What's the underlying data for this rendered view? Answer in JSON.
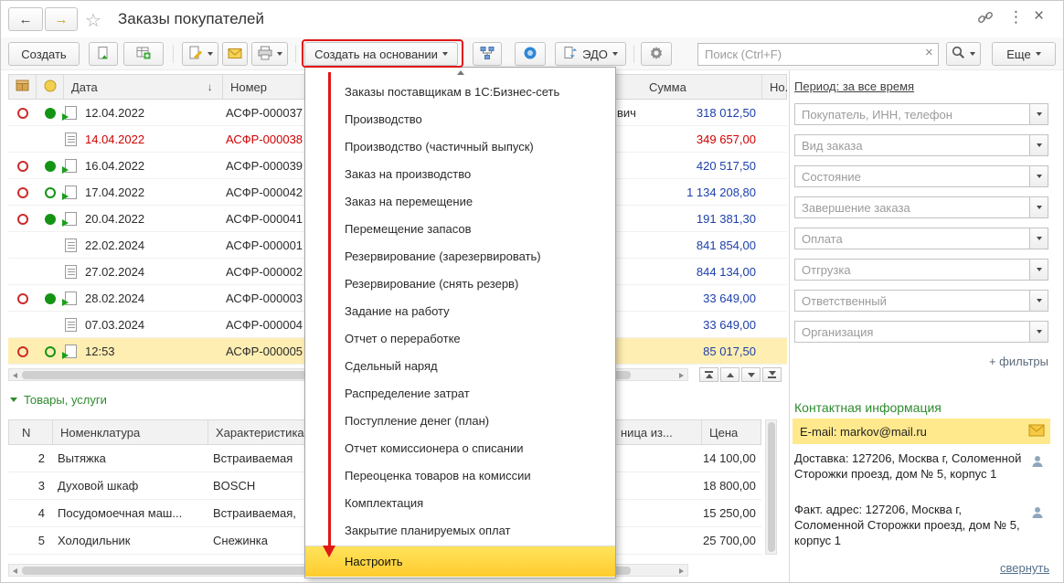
{
  "titlebar": {
    "title": "Заказы покупателей"
  },
  "toolbar": {
    "create": "Создать",
    "create_on_basis": "Создать на основании",
    "edo": "ЭДО",
    "search_placeholder": "Поиск (Ctrl+F)",
    "more": "Еще"
  },
  "orders": {
    "columns": {
      "date": "Дата",
      "number": "Номер",
      "sum": "Сумма",
      "next": "Но..."
    },
    "rows": [
      {
        "date": "12.04.2022",
        "number": "АСФР-000037",
        "tail": "вич",
        "sum": "318 012,50"
      },
      {
        "date": "14.04.2022",
        "number": "АСФР-000038",
        "sum": "349 657,00"
      },
      {
        "date": "16.04.2022",
        "number": "АСФР-000039",
        "sum": "420 517,50"
      },
      {
        "date": "17.04.2022",
        "number": "АСФР-000042",
        "sum": "1 134 208,80"
      },
      {
        "date": "20.04.2022",
        "number": "АСФР-000041",
        "sum": "191 381,30"
      },
      {
        "date": "22.02.2024",
        "number": "АСФР-000001",
        "sum": "841 854,00"
      },
      {
        "date": "27.02.2024",
        "number": "АСФР-000002",
        "sum": "844 134,00"
      },
      {
        "date": "28.02.2024",
        "number": "АСФР-000003",
        "sum": "33 649,00"
      },
      {
        "date": "07.03.2024",
        "number": "АСФР-000004",
        "sum": "33 649,00"
      },
      {
        "date": "12:53",
        "number": "АСФР-000005",
        "sum": "85 017,50"
      }
    ]
  },
  "menu": {
    "items": [
      "Заказы поставщикам в 1С:Бизнес-сеть",
      "Производство",
      "Производство (частичный выпуск)",
      "Заказ на производство",
      "Заказ на перемещение",
      "Перемещение запасов",
      "Резервирование (зарезервировать)",
      "Резервирование (снять резерв)",
      "Задание на работу",
      "Отчет о переработке",
      "Сдельный наряд",
      "Распределение затрат",
      "Поступление денег (план)",
      "Отчет комиссионера о списании",
      "Переоценка товаров на комиссии",
      "Комплектация",
      "Закрытие планируемых оплат"
    ],
    "settings": "Настроить"
  },
  "filters": {
    "period": "Период: за все время",
    "fields": [
      "Покупатель, ИНН, телефон",
      "Вид заказа",
      "Состояние",
      "Завершение заказа",
      "Оплата",
      "Отгрузка",
      "Ответственный",
      "Организация"
    ],
    "more": "+ фильтры"
  },
  "contact": {
    "title": "Контактная информация",
    "email": "E-mail: markov@mail.ru",
    "delivery": "Доставка: 127206, Москва г, Соломенной Сторожки проезд, дом № 5, корпус 1",
    "fact": "Факт. адрес: 127206, Москва г, Соломенной Сторожки проезд, дом № 5, корпус 1",
    "collapse": "свернуть"
  },
  "items": {
    "title": "Товары, услуги",
    "columns": {
      "n": "N",
      "name": "Номенклатура",
      "char": "Характеристика",
      "unit_fragment": "ница из...",
      "price": "Цена"
    },
    "rows": [
      {
        "n": "2",
        "name": "Вытяжка",
        "char": "Встраиваемая",
        "price": "14 100,00"
      },
      {
        "n": "3",
        "name": "Духовой шкаф",
        "char": "BOSCH",
        "price": "18 800,00"
      },
      {
        "n": "4",
        "name": "Посудомоечная маш...",
        "char": "Встраиваемая,",
        "price": "15 250,00"
      },
      {
        "n": "5",
        "name": "Холодильник",
        "char": "Снежинка",
        "price": "25 700,00"
      }
    ]
  }
}
